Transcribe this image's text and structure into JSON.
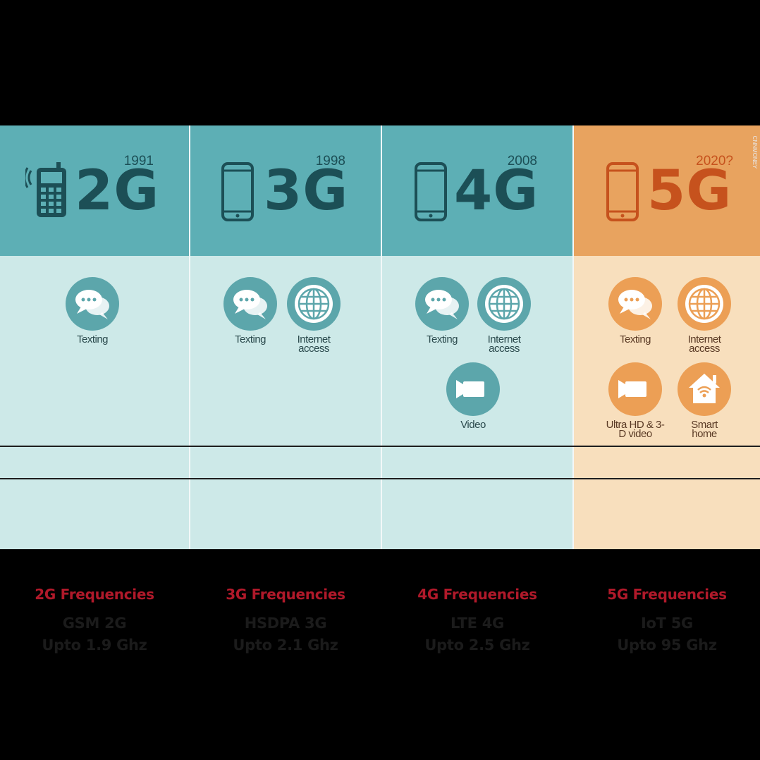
{
  "colors": {
    "teal_header": "#5dafb5",
    "teal_body": "#cde9e8",
    "teal_dark": "#1c4f56",
    "orange_header": "#e8a35f",
    "orange_body": "#f8dfbd",
    "orange_dark": "#c6521d",
    "icon_teal": "#5ca6ab",
    "icon_orange": "#ec9f55",
    "freq_red": "#b0192a"
  },
  "watermark": "CNNMONEY",
  "columns": [
    {
      "generation": "2G",
      "year": "1991",
      "features": [
        {
          "icon": "chat-bubbles-icon",
          "label": "Texting"
        }
      ],
      "freq_title": "2G Frequencies",
      "spec_line1": "GSM 2G",
      "spec_line2": "Upto 1.9 Ghz"
    },
    {
      "generation": "3G",
      "year": "1998",
      "features": [
        {
          "icon": "chat-bubbles-icon",
          "label": "Texting"
        },
        {
          "icon": "globe-icon",
          "label": "Internet access"
        }
      ],
      "freq_title": "3G Frequencies",
      "spec_line1": "HSDPA 3G",
      "spec_line2": "Upto 2.1 Ghz"
    },
    {
      "generation": "4G",
      "year": "2008",
      "features": [
        {
          "icon": "chat-bubbles-icon",
          "label": "Texting"
        },
        {
          "icon": "globe-icon",
          "label": "Internet access"
        },
        {
          "icon": "video-camera-icon",
          "label": "Video"
        }
      ],
      "freq_title": "4G Frequencies",
      "spec_line1": "LTE 4G",
      "spec_line2": "Upto 2.5 Ghz"
    },
    {
      "generation": "5G",
      "year": "2020?",
      "features": [
        {
          "icon": "chat-bubbles-icon",
          "label": "Texting"
        },
        {
          "icon": "globe-icon",
          "label": "Internet access"
        },
        {
          "icon": "video-camera-icon",
          "label": "Ultra HD & 3-D video"
        },
        {
          "icon": "smart-home-icon",
          "label": "Smart home"
        }
      ],
      "freq_title": "5G Frequencies",
      "spec_line1": "IoT 5G",
      "spec_line2": "Upto 95 Ghz"
    }
  ]
}
